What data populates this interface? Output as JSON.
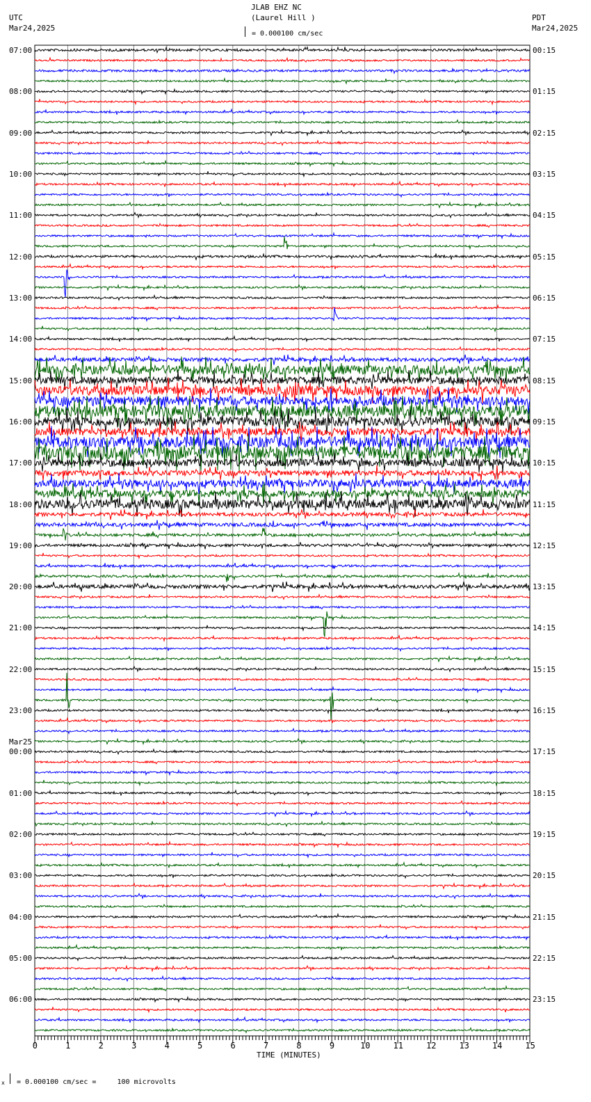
{
  "header": {
    "title": "JLAB EHZ NC",
    "subtitle": "(Laurel Hill )",
    "left_zone": "UTC",
    "left_date": "Mar24,2025",
    "right_zone": "PDT",
    "right_date": "Mar24,2025",
    "scale": "= 0.000100 cm/sec"
  },
  "footer": {
    "scale": "= 0.000100 cm/sec =     100 microvolts",
    "mark": "x"
  },
  "chart_data": {
    "type": "line",
    "title": "JLAB EHZ NC (Laurel Hill )",
    "xlabel": "TIME (MINUTES)",
    "xlim": [
      0,
      15
    ],
    "x_ticks": [
      "0",
      "1",
      "2",
      "3",
      "4",
      "5",
      "6",
      "7",
      "8",
      "9",
      "10",
      "11",
      "12",
      "13",
      "14",
      "15"
    ],
    "traces_per_hour": 4,
    "trace_colors": [
      "#000000",
      "#ff0000",
      "#0000ff",
      "#006400"
    ],
    "left_labels": [
      "07:00",
      "08:00",
      "09:00",
      "10:00",
      "11:00",
      "12:00",
      "13:00",
      "14:00",
      "15:00",
      "16:00",
      "17:00",
      "18:00",
      "19:00",
      "20:00",
      "21:00",
      "22:00",
      "23:00",
      "00:00",
      "01:00",
      "02:00",
      "03:00",
      "04:00",
      "05:00",
      "06:00"
    ],
    "date_change_label": "Mar25",
    "date_change_index": 17,
    "right_labels": [
      "00:15",
      "01:15",
      "02:15",
      "03:15",
      "04:15",
      "05:15",
      "06:15",
      "07:15",
      "08:15",
      "09:15",
      "10:15",
      "11:15",
      "12:15",
      "13:15",
      "14:15",
      "15:15",
      "16:15",
      "17:15",
      "18:15",
      "19:15",
      "20:15",
      "21:15",
      "22:15",
      "23:15"
    ],
    "activity": [
      1.3,
      1,
      1.2,
      1,
      1,
      1,
      1,
      1,
      1,
      1,
      1,
      1,
      1,
      1,
      1,
      1,
      1,
      1,
      1,
      1,
      1.2,
      1,
      1,
      1,
      1,
      1,
      1,
      1,
      1,
      1,
      2,
      5,
      4,
      5,
      5,
      6,
      5,
      4,
      6,
      7,
      4,
      3,
      4,
      4,
      5,
      2,
      2,
      1.5,
      1.5,
      1,
      1.2,
      1.3,
      2,
      1,
      1,
      1,
      1,
      1,
      1,
      1,
      1,
      1,
      1,
      1,
      1,
      1,
      1,
      1,
      1,
      1,
      1,
      1,
      1,
      1,
      1,
      1,
      1,
      1,
      1,
      1,
      1,
      1,
      1,
      1,
      1,
      1,
      1,
      1,
      1,
      1,
      1,
      1,
      1,
      1,
      1,
      1
    ],
    "events": [
      {
        "trace": 19,
        "minute": 7.55,
        "amp": 60
      },
      {
        "trace": 22,
        "minute": 0.9,
        "amp": 80
      },
      {
        "trace": 26,
        "minute": 9.05,
        "amp": 40
      },
      {
        "trace": 36,
        "minute": 7.55,
        "amp": 40
      },
      {
        "trace": 43,
        "minute": 6.9,
        "amp": 50
      },
      {
        "trace": 47,
        "minute": 6.9,
        "amp": 45
      },
      {
        "trace": 47,
        "minute": 0.85,
        "amp": 60
      },
      {
        "trace": 51,
        "minute": 5.8,
        "amp": 25
      },
      {
        "trace": 55,
        "minute": 8.75,
        "amp": 120
      },
      {
        "trace": 63,
        "minute": 0.95,
        "amp": 120
      },
      {
        "trace": 63,
        "minute": 8.95,
        "amp": 110
      }
    ]
  }
}
